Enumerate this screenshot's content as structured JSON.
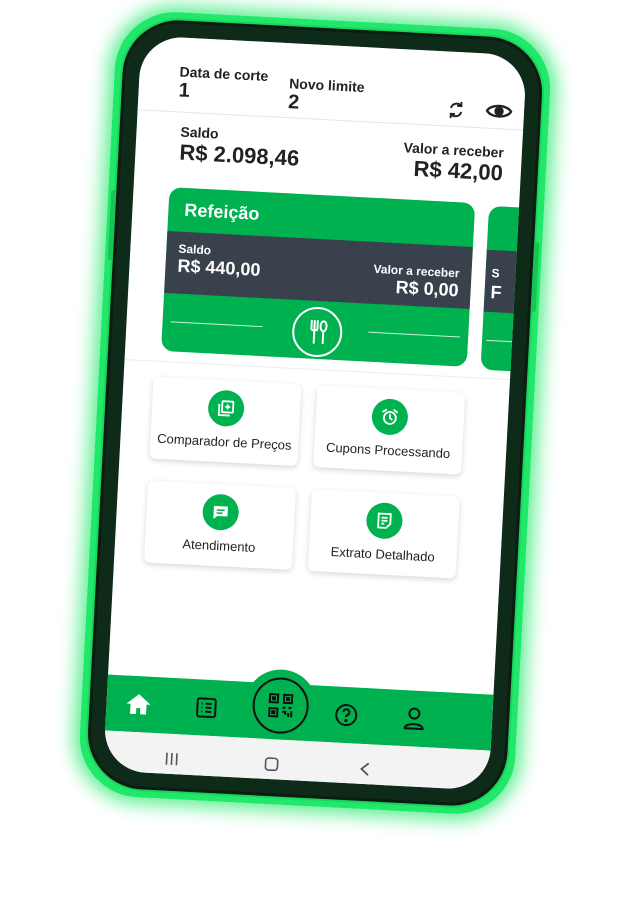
{
  "header": {
    "cutoff_label": "Data de corte",
    "cutoff_value": "1",
    "limit_label": "Novo limite",
    "limit_value": "2"
  },
  "balance": {
    "label": "Saldo",
    "value": "R$ 2.098,46",
    "receivable_label": "Valor a receber",
    "receivable_value": "R$ 42,00"
  },
  "card": {
    "title": "Refeição",
    "balance_label": "Saldo",
    "balance_value": "R$ 440,00",
    "receivable_label": "Valor a receber",
    "receivable_value": "R$ 0,00"
  },
  "card2_peek": {
    "balance_label_initial": "S",
    "value_initial": "F"
  },
  "tiles": [
    {
      "label": "Comparador de Preços",
      "icon": "copy-plus-icon"
    },
    {
      "label": "Cupons Processando",
      "icon": "alarm-clock-icon"
    },
    {
      "label": "Atendimento",
      "icon": "chat-icon"
    },
    {
      "label": "Extrato Detalhado",
      "icon": "document-icon"
    }
  ],
  "nav": {
    "items": [
      "home-icon",
      "list-icon",
      "qr-code-icon",
      "help-icon",
      "user-icon"
    ]
  },
  "colors": {
    "brand_green": "#00b14f",
    "dark_band": "#39424c",
    "glow": "#21e86a"
  }
}
